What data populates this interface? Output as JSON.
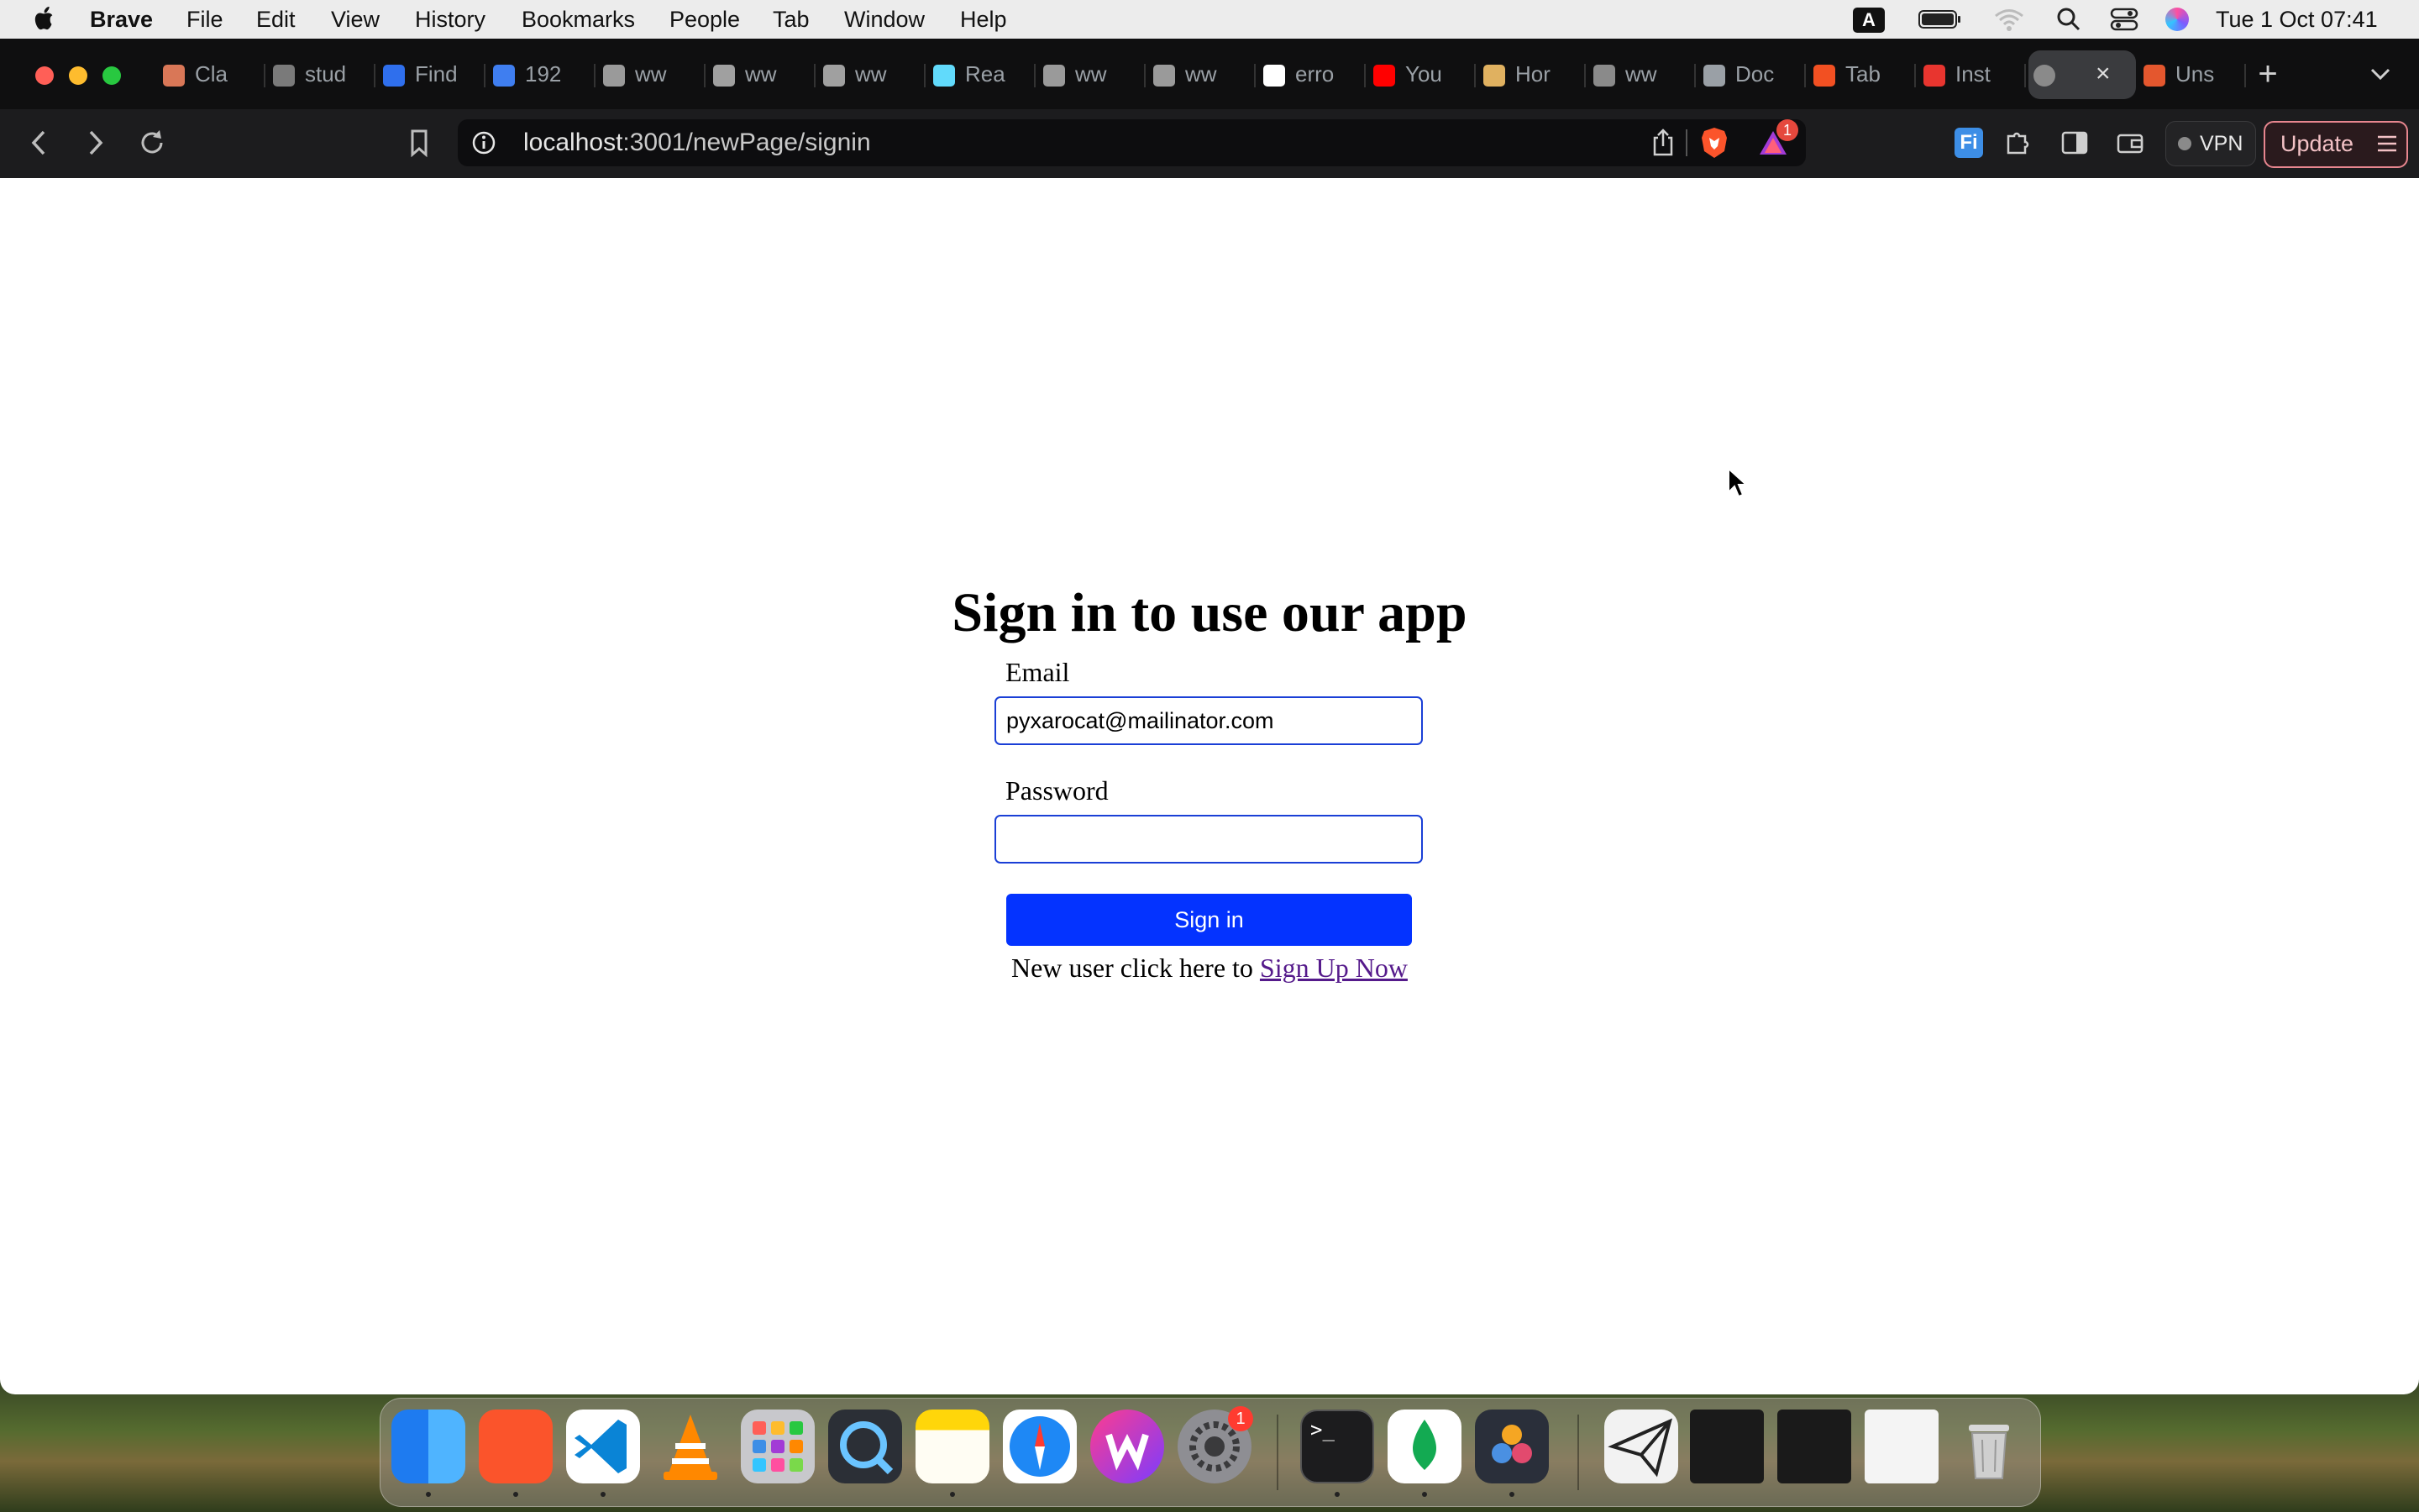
{
  "menubar": {
    "app_name": "Brave",
    "items": [
      "File",
      "Edit",
      "View",
      "History",
      "Bookmarks",
      "People",
      "Tab",
      "Window",
      "Help"
    ],
    "input_source": "A",
    "datetime": "Tue 1 Oct  07:41"
  },
  "tabs": [
    {
      "label": "Cla",
      "color": "#d97757"
    },
    {
      "label": "stud",
      "color": "#7a7a7a"
    },
    {
      "label": "Find",
      "color": "#2f6fed"
    },
    {
      "label": "192",
      "color": "#3f7ef0"
    },
    {
      "label": "ww",
      "color": "#9a9a9a"
    },
    {
      "label": "ww",
      "color": "#a0a0a0"
    },
    {
      "label": "ww",
      "color": "#a0a0a0"
    },
    {
      "label": "Rea",
      "color": "#61dafb"
    },
    {
      "label": "ww",
      "color": "#9a9a9a"
    },
    {
      "label": "ww",
      "color": "#9a9a9a"
    },
    {
      "label": "erro",
      "color": "#ffffff"
    },
    {
      "label": "You",
      "color": "#ff0000"
    },
    {
      "label": "Hor",
      "color": "#e0b160"
    },
    {
      "label": "ww",
      "color": "#8a8a8a"
    },
    {
      "label": "Doc",
      "color": "#9aa0a6"
    },
    {
      "label": "Tab",
      "color": "#f25022"
    },
    {
      "label": "Inst",
      "color": "#e8352f"
    },
    {
      "label": "",
      "color": "#8a8a8a",
      "active": true
    },
    {
      "label": "Uns",
      "color": "#e4572e"
    }
  ],
  "address_bar": {
    "host": "localhost",
    "path": ":3001/newPage/signin",
    "shield_badge": "1"
  },
  "toolbar": {
    "vpn_label": "VPN",
    "update_label": "Update"
  },
  "page": {
    "heading": "Sign in to use our app",
    "email_label": "Email",
    "email_value": "pyxarocat@mailinator.com",
    "password_label": "Password",
    "password_value": "",
    "submit_label": "Sign in",
    "signup_prompt": "New user click here to ",
    "signup_link": "Sign Up Now"
  },
  "dock": {
    "settings_badge": "1",
    "apps": [
      "finder",
      "brave",
      "vscode",
      "vlc",
      "launchpad",
      "quicktime",
      "notes",
      "safari",
      "wps",
      "system-settings",
      "terminal",
      "mongodb-compass",
      "davinci-resolve"
    ]
  },
  "colors": {
    "accent_button": "#0433ff",
    "field_border": "#1a3fd6",
    "link_visited": "#551a8b",
    "update_border": "#e7868f"
  }
}
